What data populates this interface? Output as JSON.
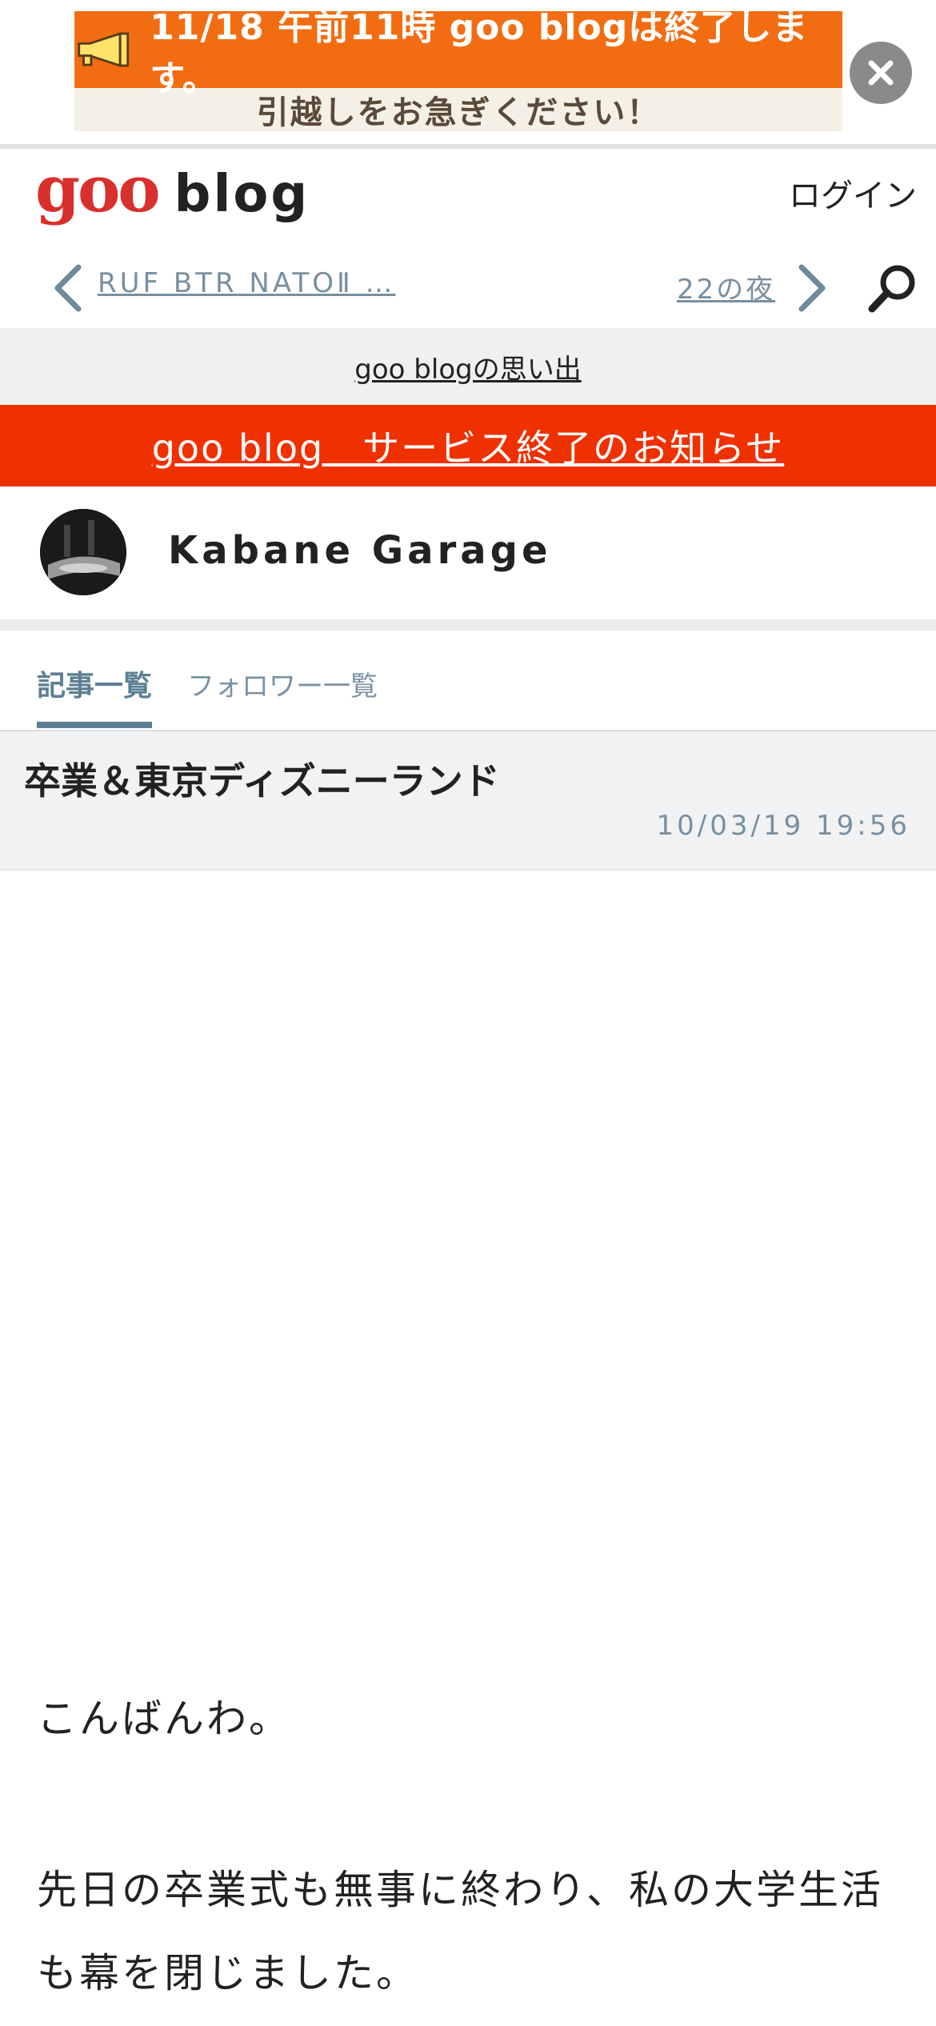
{
  "banner": {
    "line1": "11/18 午前11時 goo blogは終了します。",
    "line2": "引越しをお急ぎください！",
    "colors": {
      "top": "#f26d12",
      "bottom": "#f5f0e6"
    }
  },
  "header": {
    "logo_goo": "goo",
    "logo_blog": "blog",
    "login": "ログイン"
  },
  "nav": {
    "prev_label": "RUF BTR NATOⅡ …",
    "next_label": "22の夜"
  },
  "memories_link": "goo blogの思い出",
  "notice_link": "goo blog　サービス終了のお知らせ",
  "blog": {
    "name": "Kabane Garage"
  },
  "tabs": [
    {
      "label": "記事一覧",
      "active": true
    },
    {
      "label": "フォロワー一覧",
      "active": false
    }
  ],
  "entry": {
    "title": "卒業＆東京ディズニーランド",
    "date": "10/03/19 19:56",
    "paragraphs": [
      "こんばんわ。",
      "先日の卒業式も無事に終わり、私の大学生活も幕を閉じました。"
    ]
  },
  "colors": {
    "accent_red": "#ef3100",
    "tab_active": "#5d7f93",
    "logo_red": "#d8302c"
  }
}
